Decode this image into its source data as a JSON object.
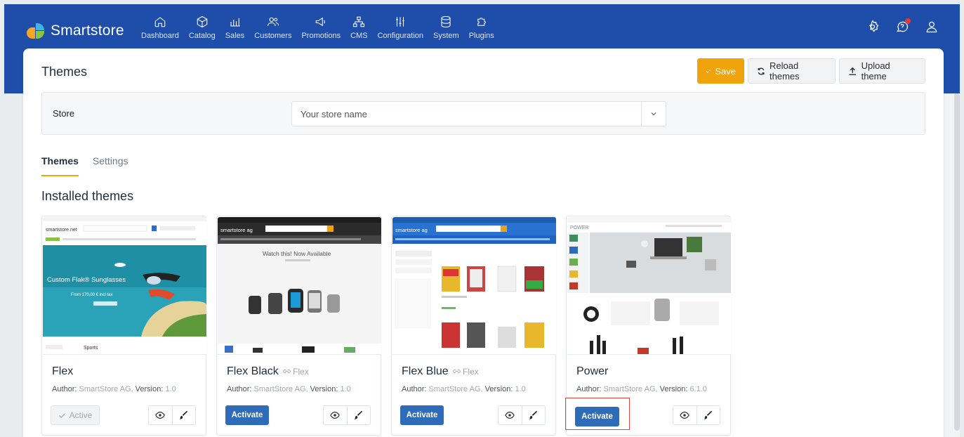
{
  "brand": {
    "name": "Smartstore"
  },
  "nav": [
    {
      "label": "Dashboard",
      "icon": "home-icon"
    },
    {
      "label": "Catalog",
      "icon": "cube-icon"
    },
    {
      "label": "Sales",
      "icon": "chart-icon"
    },
    {
      "label": "Customers",
      "icon": "users-icon"
    },
    {
      "label": "Promotions",
      "icon": "megaphone-icon"
    },
    {
      "label": "CMS",
      "icon": "sitemap-icon"
    },
    {
      "label": "Configuration",
      "icon": "sliders-icon"
    },
    {
      "label": "System",
      "icon": "database-icon"
    },
    {
      "label": "Plugins",
      "icon": "puzzle-icon"
    }
  ],
  "top_right": {
    "icons": [
      "settings-icon",
      "help-chat-icon",
      "user-icon"
    ],
    "notification_color": "#e53935"
  },
  "page": {
    "title": "Themes",
    "buttons": {
      "save": "Save",
      "reload": "Reload themes",
      "upload": "Upload theme"
    }
  },
  "store_filter": {
    "label": "Store",
    "value": "Your store name"
  },
  "tabs": [
    {
      "label": "Themes",
      "active": true
    },
    {
      "label": "Settings",
      "active": false
    }
  ],
  "installed_title": "Installed themes",
  "themes": [
    {
      "name": "Flex",
      "base": "",
      "author_label": "Author:",
      "author": "SmartStore AG,",
      "version_label": "Version:",
      "version": "1.0",
      "status": "Active",
      "thumb": {
        "brand": "smartstore.net",
        "hero": "Custom Flak® Sunglasses",
        "price": "From 170,00 € incl tax",
        "footer": "Sports"
      }
    },
    {
      "name": "Flex Black",
      "base": "Flex",
      "author_label": "Author:",
      "author": "SmartStore AG,",
      "version_label": "Version:",
      "version": "1.0",
      "status": "Activate",
      "thumb": {
        "brand": "smartstore ag",
        "hero": "Watch this! Now Available"
      }
    },
    {
      "name": "Flex Blue",
      "base": "Flex",
      "author_label": "Author:",
      "author": "SmartStore AG,",
      "version_label": "Version:",
      "version": "1.0",
      "status": "Activate",
      "thumb": {
        "brand": "smartstore ag"
      }
    },
    {
      "name": "Power",
      "base": "",
      "author_label": "Author:",
      "author": "SmartStore AG,",
      "version_label": "Version:",
      "version": "6.1.0",
      "status": "Activate",
      "thumb": {
        "brand": "POWER"
      }
    }
  ],
  "colors": {
    "nav_bg": "#1f4eaa",
    "accent": "#f0a30a",
    "primary": "#2e6bb8",
    "highlight_box": "#e0453a"
  }
}
